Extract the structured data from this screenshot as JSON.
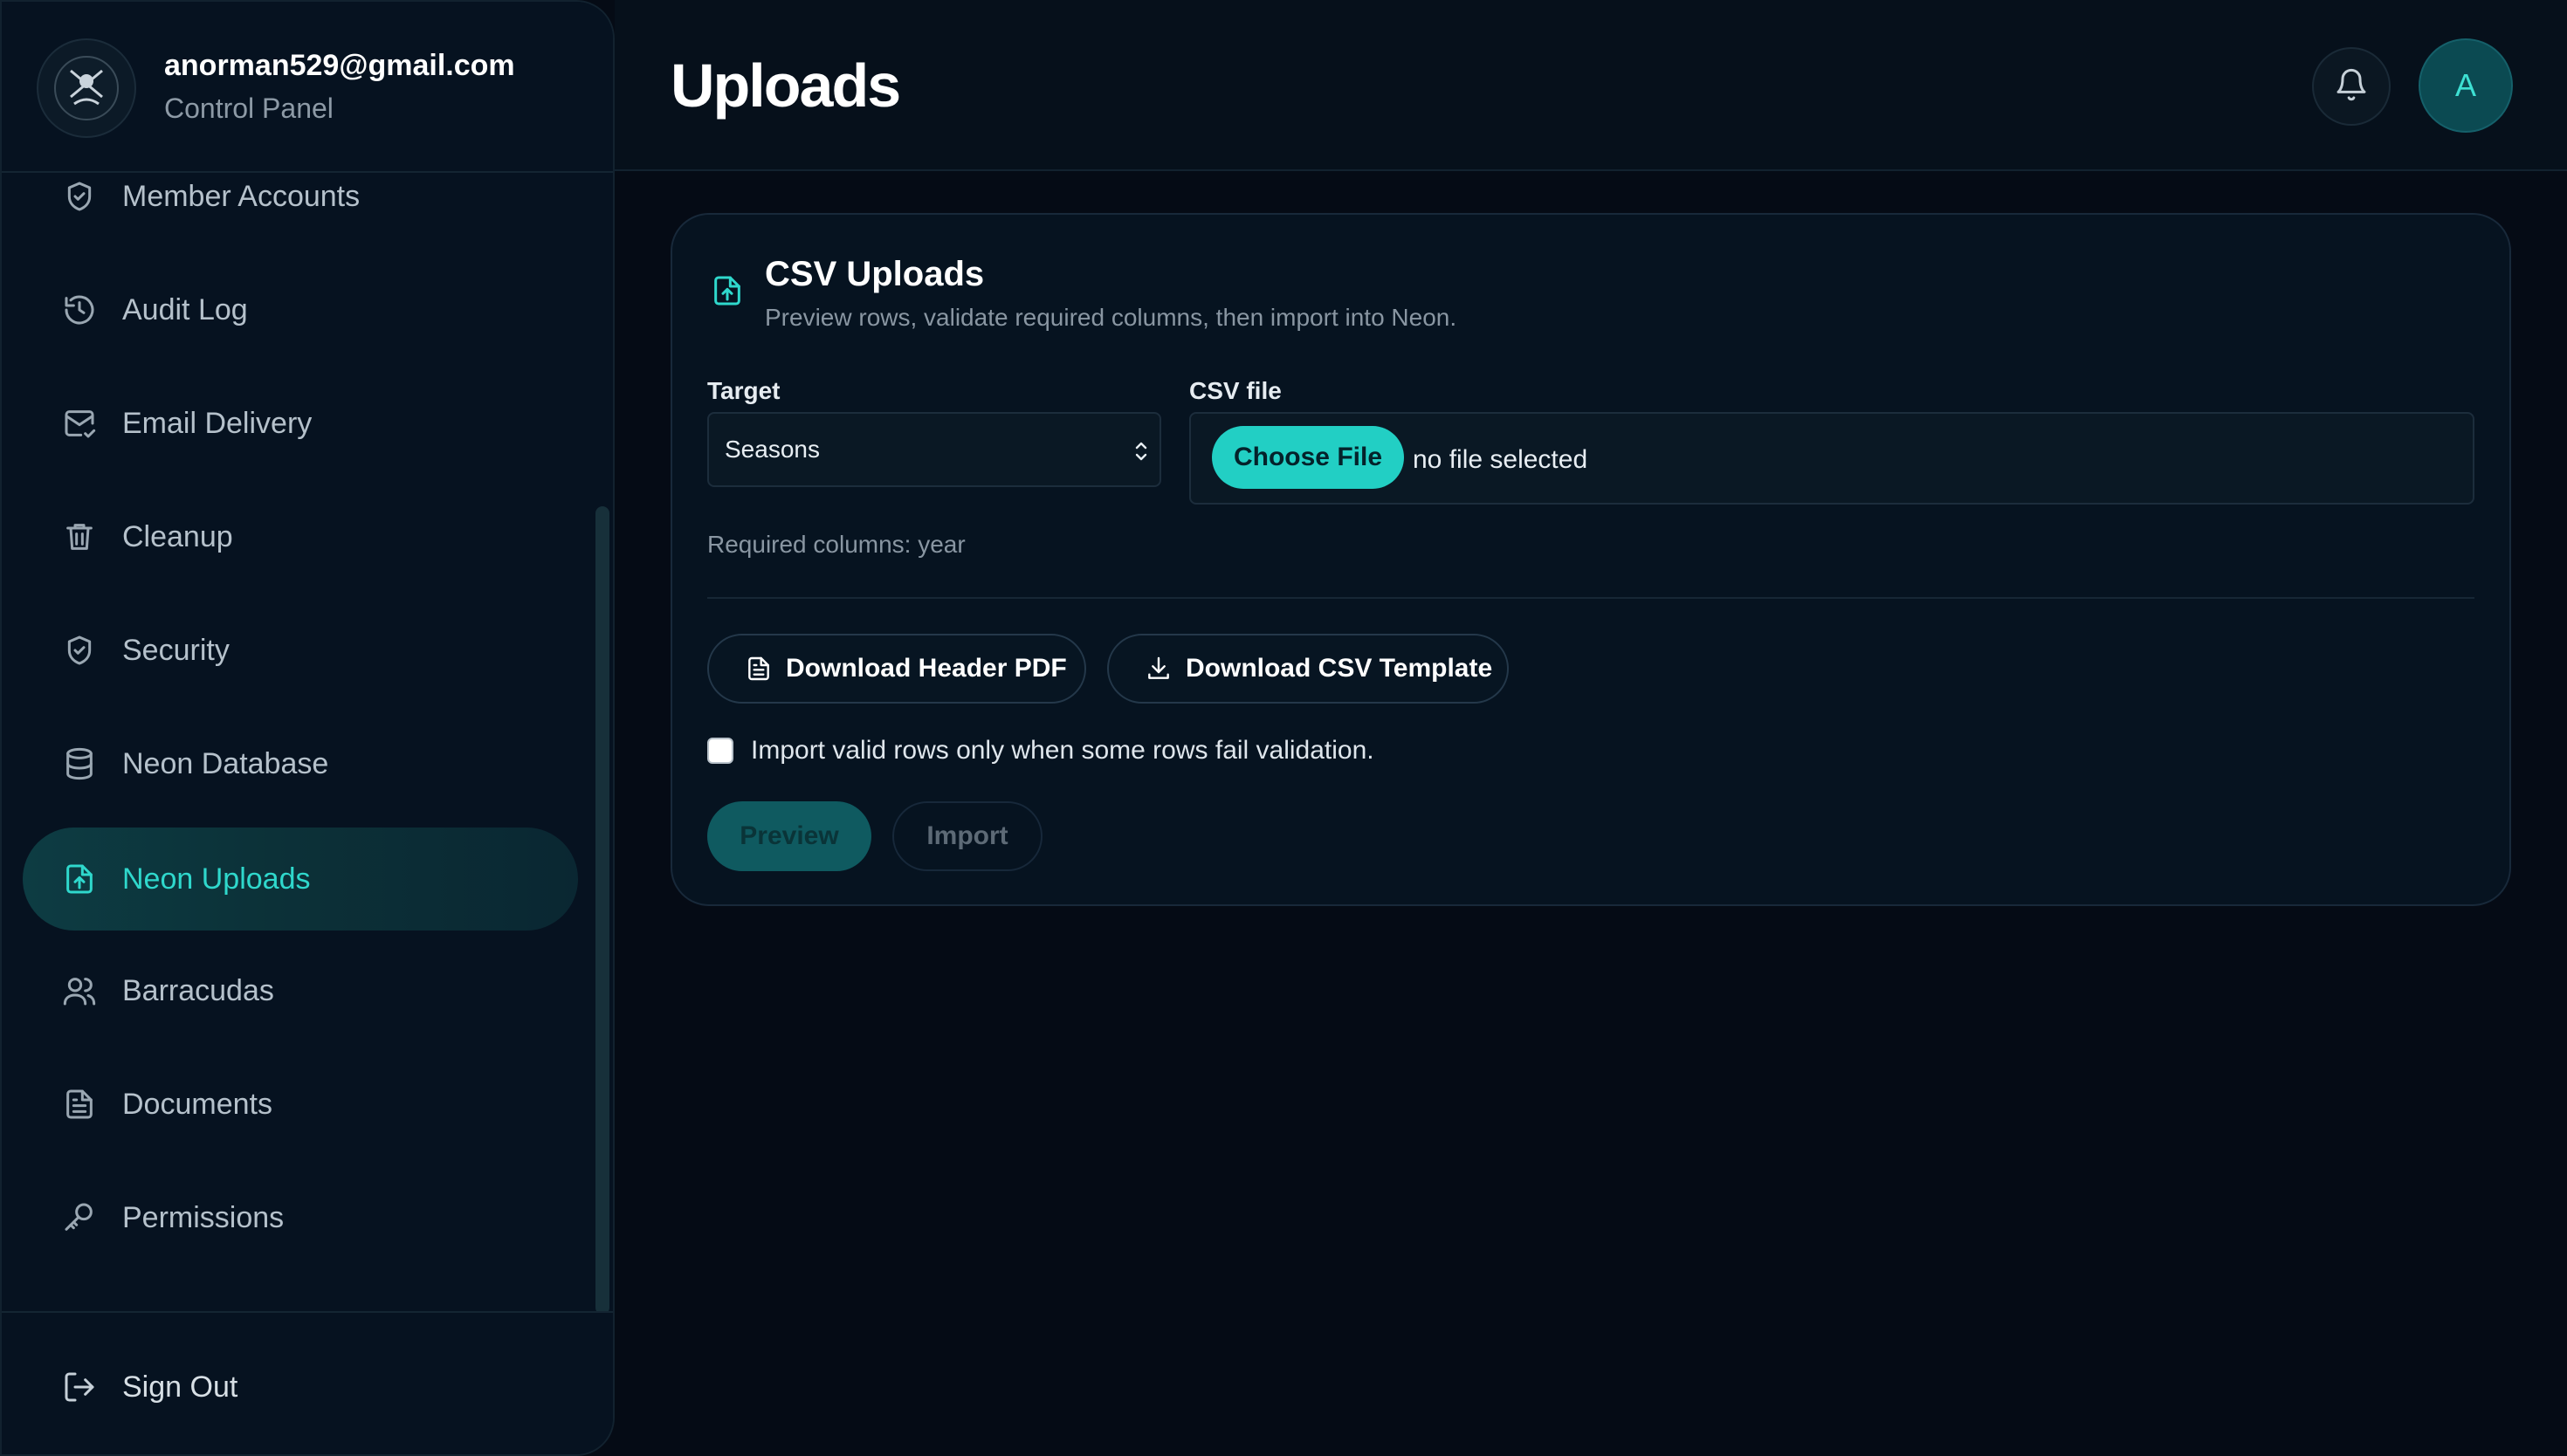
{
  "user": {
    "email": "anorman529@gmail.com",
    "role": "Control Panel",
    "avatar_initial": "A"
  },
  "sidebar": {
    "items": [
      {
        "label": "Member Accounts",
        "icon": "shield-check-icon"
      },
      {
        "label": "Audit Log",
        "icon": "history-icon"
      },
      {
        "label": "Email Delivery",
        "icon": "mail-check-icon"
      },
      {
        "label": "Cleanup",
        "icon": "trash-icon"
      },
      {
        "label": "Security",
        "icon": "shield-check-icon"
      },
      {
        "label": "Neon Database",
        "icon": "database-icon"
      },
      {
        "label": "Neon Uploads",
        "icon": "file-upload-icon",
        "active": true
      },
      {
        "label": "Barracudas",
        "icon": "users-icon"
      },
      {
        "label": "Documents",
        "icon": "document-icon"
      },
      {
        "label": "Permissions",
        "icon": "key-icon"
      }
    ],
    "sign_out": "Sign Out"
  },
  "header": {
    "title": "Uploads"
  },
  "card": {
    "title": "CSV Uploads",
    "subtitle": "Preview rows, validate required columns, then import into Neon.",
    "target_label": "Target",
    "target_value": "Seasons",
    "file_label": "CSV file",
    "choose_file": "Choose File",
    "file_status": "no file selected",
    "required_columns": "Required columns: year",
    "download_pdf": "Download Header PDF",
    "download_csv": "Download CSV Template",
    "checkbox_label": "Import valid rows only when some rows fail validation.",
    "checkbox_checked": false,
    "preview": "Preview",
    "import": "Import"
  },
  "colors": {
    "accent": "#22cfc4",
    "background": "#050b15",
    "panel": "#061320"
  }
}
